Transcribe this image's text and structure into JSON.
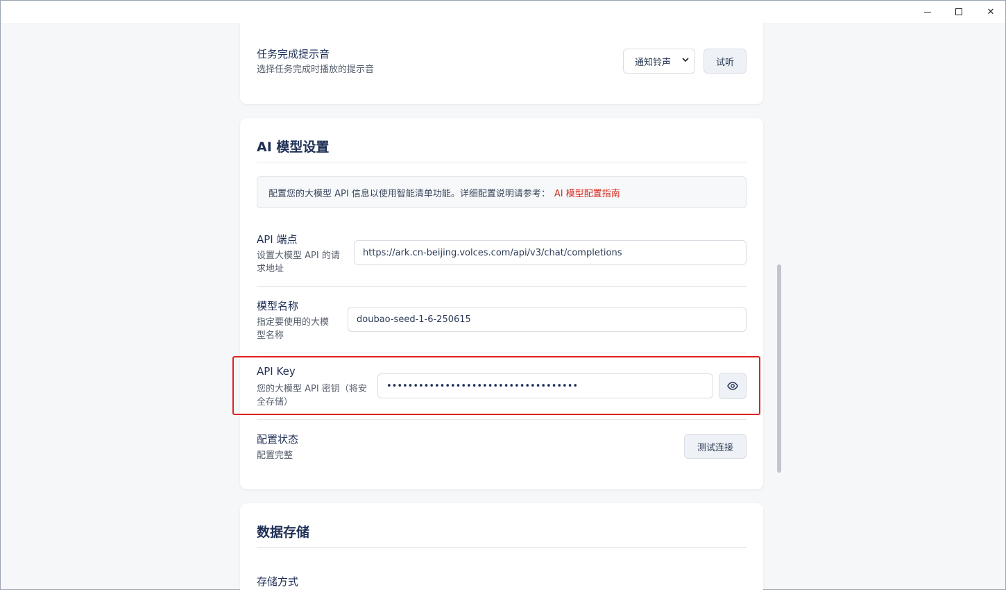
{
  "window": {
    "minimize_glyph": "",
    "close_glyph": "✕"
  },
  "sound": {
    "title": "任务完成提示音",
    "desc": "选择任务完成时播放的提示音",
    "select_value": "通知铃声",
    "preview_button": "试听"
  },
  "ai": {
    "section_title": "AI 模型设置",
    "info_text": "配置您的大模型 API 信息以使用智能清单功能。详细配置说明请参考：",
    "info_link": "AI 模型配置指南",
    "endpoint": {
      "title": "API 端点",
      "desc_line1": "设置大模型 API 的请",
      "desc_line2": "求地址",
      "value": "https://ark.cn-beijing.volces.com/api/v3/chat/completions"
    },
    "model": {
      "title": "模型名称",
      "desc_line1": "指定要使用的大模",
      "desc_line2": "型名称",
      "value": "doubao-seed-1-6-250615"
    },
    "apikey": {
      "title": "API Key",
      "desc_line1": "您的大模型 API 密钥（将安",
      "desc_line2": "全存储）",
      "masked_value": "••••••••••••••••••••••••••••••••••••"
    },
    "status": {
      "title": "配置状态",
      "desc": "配置完整",
      "test_button": "测试连接"
    }
  },
  "storage": {
    "section_title": "数据存储",
    "method_title": "存储方式"
  },
  "colors": {
    "accent_red": "#e02020",
    "link_red": "#d52b1e",
    "heading_navy": "#1e2f55"
  }
}
